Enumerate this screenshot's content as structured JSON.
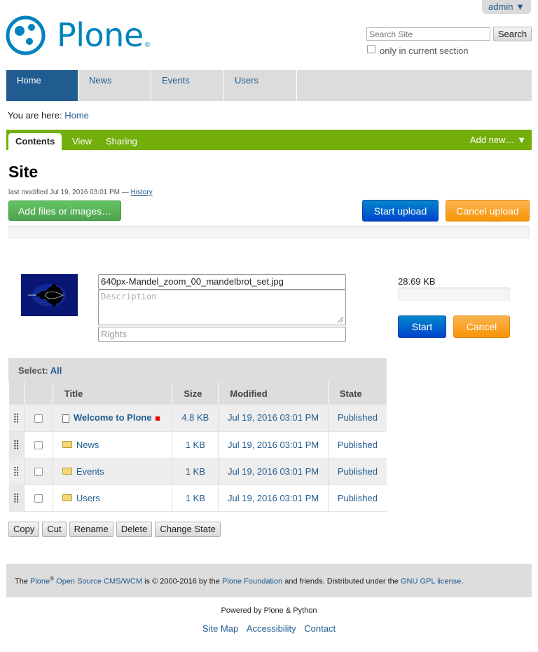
{
  "header": {
    "user_menu": "admin ▼",
    "logo_text": "Plone",
    "logo_mark": "®",
    "search_placeholder": "Search Site",
    "search_button": "Search",
    "search_section_label": "only in current section"
  },
  "nav": {
    "items": [
      {
        "label": "Home"
      },
      {
        "label": "News"
      },
      {
        "label": "Events"
      },
      {
        "label": "Users"
      }
    ]
  },
  "breadcrumb": {
    "prefix": "You are here:",
    "home": "Home"
  },
  "toolbar": {
    "tabs": [
      "Contents",
      "View",
      "Sharing"
    ],
    "add_new": "Add new… ▼"
  },
  "page": {
    "title": "Site",
    "byline_prefix": "last modified Jul 19, 2016 03:01 PM —",
    "history_link": "History"
  },
  "upload": {
    "add_button": "Add files or images…",
    "start_upload": "Start upload",
    "cancel_upload": "Cancel upload",
    "file": {
      "name": "640px-Mandel_zoom_00_mandelbrot_set.jpg",
      "description_placeholder": "Description",
      "rights_placeholder": "Rights",
      "size": "28.69 KB",
      "start": "Start",
      "cancel": "Cancel"
    }
  },
  "table": {
    "select_label": "Select:",
    "select_all": "All",
    "columns": [
      "Title",
      "Size",
      "Modified",
      "State"
    ],
    "rows": [
      {
        "title": "Welcome to Plone",
        "size": "4.8 KB",
        "modified": "Jul 19, 2016 03:01 PM",
        "state": "Published",
        "type": "document"
      },
      {
        "title": "News",
        "size": "1 KB",
        "modified": "Jul 19, 2016 03:01 PM",
        "state": "Published",
        "type": "folder"
      },
      {
        "title": "Events",
        "size": "1 KB",
        "modified": "Jul 19, 2016 03:01 PM",
        "state": "Published",
        "type": "folder"
      },
      {
        "title": "Users",
        "size": "1 KB",
        "modified": "Jul 19, 2016 03:01 PM",
        "state": "Published",
        "type": "folder"
      }
    ]
  },
  "actions": [
    "Copy",
    "Cut",
    "Rename",
    "Delete",
    "Change State"
  ],
  "footer": {
    "t1": "The",
    "plone": "Plone",
    "reg": "®",
    "cms": "Open Source CMS/WCM",
    "t2": "is © 2000-2016 by the",
    "foundation": "Plone Foundation",
    "t3": "and friends. Distributed under the",
    "license": "GNU GPL license",
    "t4": ".",
    "powered": "Powered by Plone & Python",
    "links": [
      "Site Map",
      "Accessibility",
      "Contact"
    ]
  },
  "colors": {
    "brand_blue": "#0083be",
    "nav_active": "#205c90",
    "toolbar_green": "#74ae0b",
    "success": "#51a351",
    "primary": "#0044cc",
    "warning": "#f89406"
  }
}
